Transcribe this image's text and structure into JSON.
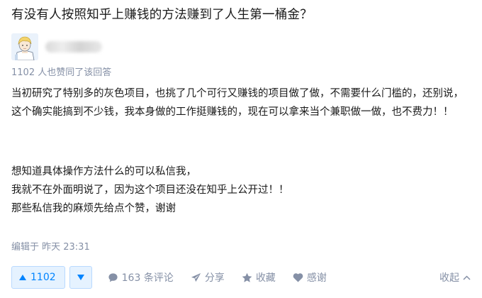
{
  "question": {
    "title": "有没有人按照知乎上赚钱的方法赚到了人生第一桶金？"
  },
  "answer": {
    "upvote_note": "1102 人也赞同了该回答",
    "paragraphs": [
      "当初研究了特别多的灰色项目，也挑了几个可行又赚钱的项目做了做，不需要什么门槛的，还别说，这个确实能搞到不少钱，我本身做的工作挺赚钱的，现在可以拿来当个兼职做一做，也不费力！！",
      "想知道具体操作方法什么的可以私信我，",
      "我就不在外面明说了，因为这个项目还没在知乎上公开过！！",
      "那些私信我的麻烦先给点个赞，谢谢"
    ],
    "edit_time": "编辑于 昨天 23:31"
  },
  "actions": {
    "upvote_count": "1102",
    "comments": "163 条评论",
    "share": "分享",
    "favorite": "收藏",
    "thanks": "感谢",
    "collapse": "收起"
  },
  "icons": {
    "upvote": "triangle-up-icon",
    "downvote": "triangle-down-icon",
    "comment": "comment-bubble-icon",
    "share": "paper-plane-icon",
    "favorite": "star-icon",
    "thanks": "heart-icon",
    "collapse": "chevron-up-icon"
  },
  "colors": {
    "accent": "#0084ff",
    "accent_bg": "#e5f2ff",
    "muted": "#8590a6",
    "text": "#1a1a1a"
  }
}
